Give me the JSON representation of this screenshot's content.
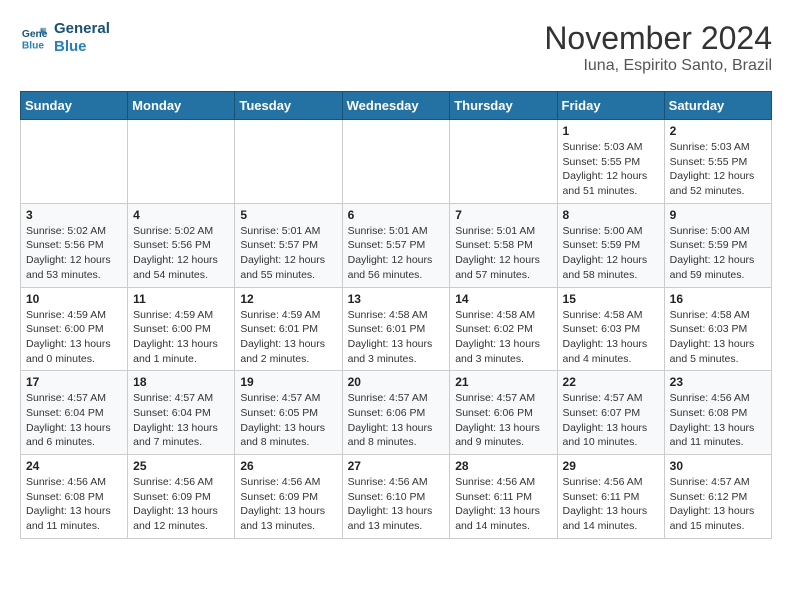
{
  "header": {
    "logo_line1": "General",
    "logo_line2": "Blue",
    "month": "November 2024",
    "location": "Iuna, Espirito Santo, Brazil"
  },
  "weekdays": [
    "Sunday",
    "Monday",
    "Tuesday",
    "Wednesday",
    "Thursday",
    "Friday",
    "Saturday"
  ],
  "weeks": [
    [
      {
        "day": "",
        "info": ""
      },
      {
        "day": "",
        "info": ""
      },
      {
        "day": "",
        "info": ""
      },
      {
        "day": "",
        "info": ""
      },
      {
        "day": "",
        "info": ""
      },
      {
        "day": "1",
        "info": "Sunrise: 5:03 AM\nSunset: 5:55 PM\nDaylight: 12 hours\nand 51 minutes."
      },
      {
        "day": "2",
        "info": "Sunrise: 5:03 AM\nSunset: 5:55 PM\nDaylight: 12 hours\nand 52 minutes."
      }
    ],
    [
      {
        "day": "3",
        "info": "Sunrise: 5:02 AM\nSunset: 5:56 PM\nDaylight: 12 hours\nand 53 minutes."
      },
      {
        "day": "4",
        "info": "Sunrise: 5:02 AM\nSunset: 5:56 PM\nDaylight: 12 hours\nand 54 minutes."
      },
      {
        "day": "5",
        "info": "Sunrise: 5:01 AM\nSunset: 5:57 PM\nDaylight: 12 hours\nand 55 minutes."
      },
      {
        "day": "6",
        "info": "Sunrise: 5:01 AM\nSunset: 5:57 PM\nDaylight: 12 hours\nand 56 minutes."
      },
      {
        "day": "7",
        "info": "Sunrise: 5:01 AM\nSunset: 5:58 PM\nDaylight: 12 hours\nand 57 minutes."
      },
      {
        "day": "8",
        "info": "Sunrise: 5:00 AM\nSunset: 5:59 PM\nDaylight: 12 hours\nand 58 minutes."
      },
      {
        "day": "9",
        "info": "Sunrise: 5:00 AM\nSunset: 5:59 PM\nDaylight: 12 hours\nand 59 minutes."
      }
    ],
    [
      {
        "day": "10",
        "info": "Sunrise: 4:59 AM\nSunset: 6:00 PM\nDaylight: 13 hours\nand 0 minutes."
      },
      {
        "day": "11",
        "info": "Sunrise: 4:59 AM\nSunset: 6:00 PM\nDaylight: 13 hours\nand 1 minute."
      },
      {
        "day": "12",
        "info": "Sunrise: 4:59 AM\nSunset: 6:01 PM\nDaylight: 13 hours\nand 2 minutes."
      },
      {
        "day": "13",
        "info": "Sunrise: 4:58 AM\nSunset: 6:01 PM\nDaylight: 13 hours\nand 3 minutes."
      },
      {
        "day": "14",
        "info": "Sunrise: 4:58 AM\nSunset: 6:02 PM\nDaylight: 13 hours\nand 3 minutes."
      },
      {
        "day": "15",
        "info": "Sunrise: 4:58 AM\nSunset: 6:03 PM\nDaylight: 13 hours\nand 4 minutes."
      },
      {
        "day": "16",
        "info": "Sunrise: 4:58 AM\nSunset: 6:03 PM\nDaylight: 13 hours\nand 5 minutes."
      }
    ],
    [
      {
        "day": "17",
        "info": "Sunrise: 4:57 AM\nSunset: 6:04 PM\nDaylight: 13 hours\nand 6 minutes."
      },
      {
        "day": "18",
        "info": "Sunrise: 4:57 AM\nSunset: 6:04 PM\nDaylight: 13 hours\nand 7 minutes."
      },
      {
        "day": "19",
        "info": "Sunrise: 4:57 AM\nSunset: 6:05 PM\nDaylight: 13 hours\nand 8 minutes."
      },
      {
        "day": "20",
        "info": "Sunrise: 4:57 AM\nSunset: 6:06 PM\nDaylight: 13 hours\nand 8 minutes."
      },
      {
        "day": "21",
        "info": "Sunrise: 4:57 AM\nSunset: 6:06 PM\nDaylight: 13 hours\nand 9 minutes."
      },
      {
        "day": "22",
        "info": "Sunrise: 4:57 AM\nSunset: 6:07 PM\nDaylight: 13 hours\nand 10 minutes."
      },
      {
        "day": "23",
        "info": "Sunrise: 4:56 AM\nSunset: 6:08 PM\nDaylight: 13 hours\nand 11 minutes."
      }
    ],
    [
      {
        "day": "24",
        "info": "Sunrise: 4:56 AM\nSunset: 6:08 PM\nDaylight: 13 hours\nand 11 minutes."
      },
      {
        "day": "25",
        "info": "Sunrise: 4:56 AM\nSunset: 6:09 PM\nDaylight: 13 hours\nand 12 minutes."
      },
      {
        "day": "26",
        "info": "Sunrise: 4:56 AM\nSunset: 6:09 PM\nDaylight: 13 hours\nand 13 minutes."
      },
      {
        "day": "27",
        "info": "Sunrise: 4:56 AM\nSunset: 6:10 PM\nDaylight: 13 hours\nand 13 minutes."
      },
      {
        "day": "28",
        "info": "Sunrise: 4:56 AM\nSunset: 6:11 PM\nDaylight: 13 hours\nand 14 minutes."
      },
      {
        "day": "29",
        "info": "Sunrise: 4:56 AM\nSunset: 6:11 PM\nDaylight: 13 hours\nand 14 minutes."
      },
      {
        "day": "30",
        "info": "Sunrise: 4:57 AM\nSunset: 6:12 PM\nDaylight: 13 hours\nand 15 minutes."
      }
    ]
  ]
}
